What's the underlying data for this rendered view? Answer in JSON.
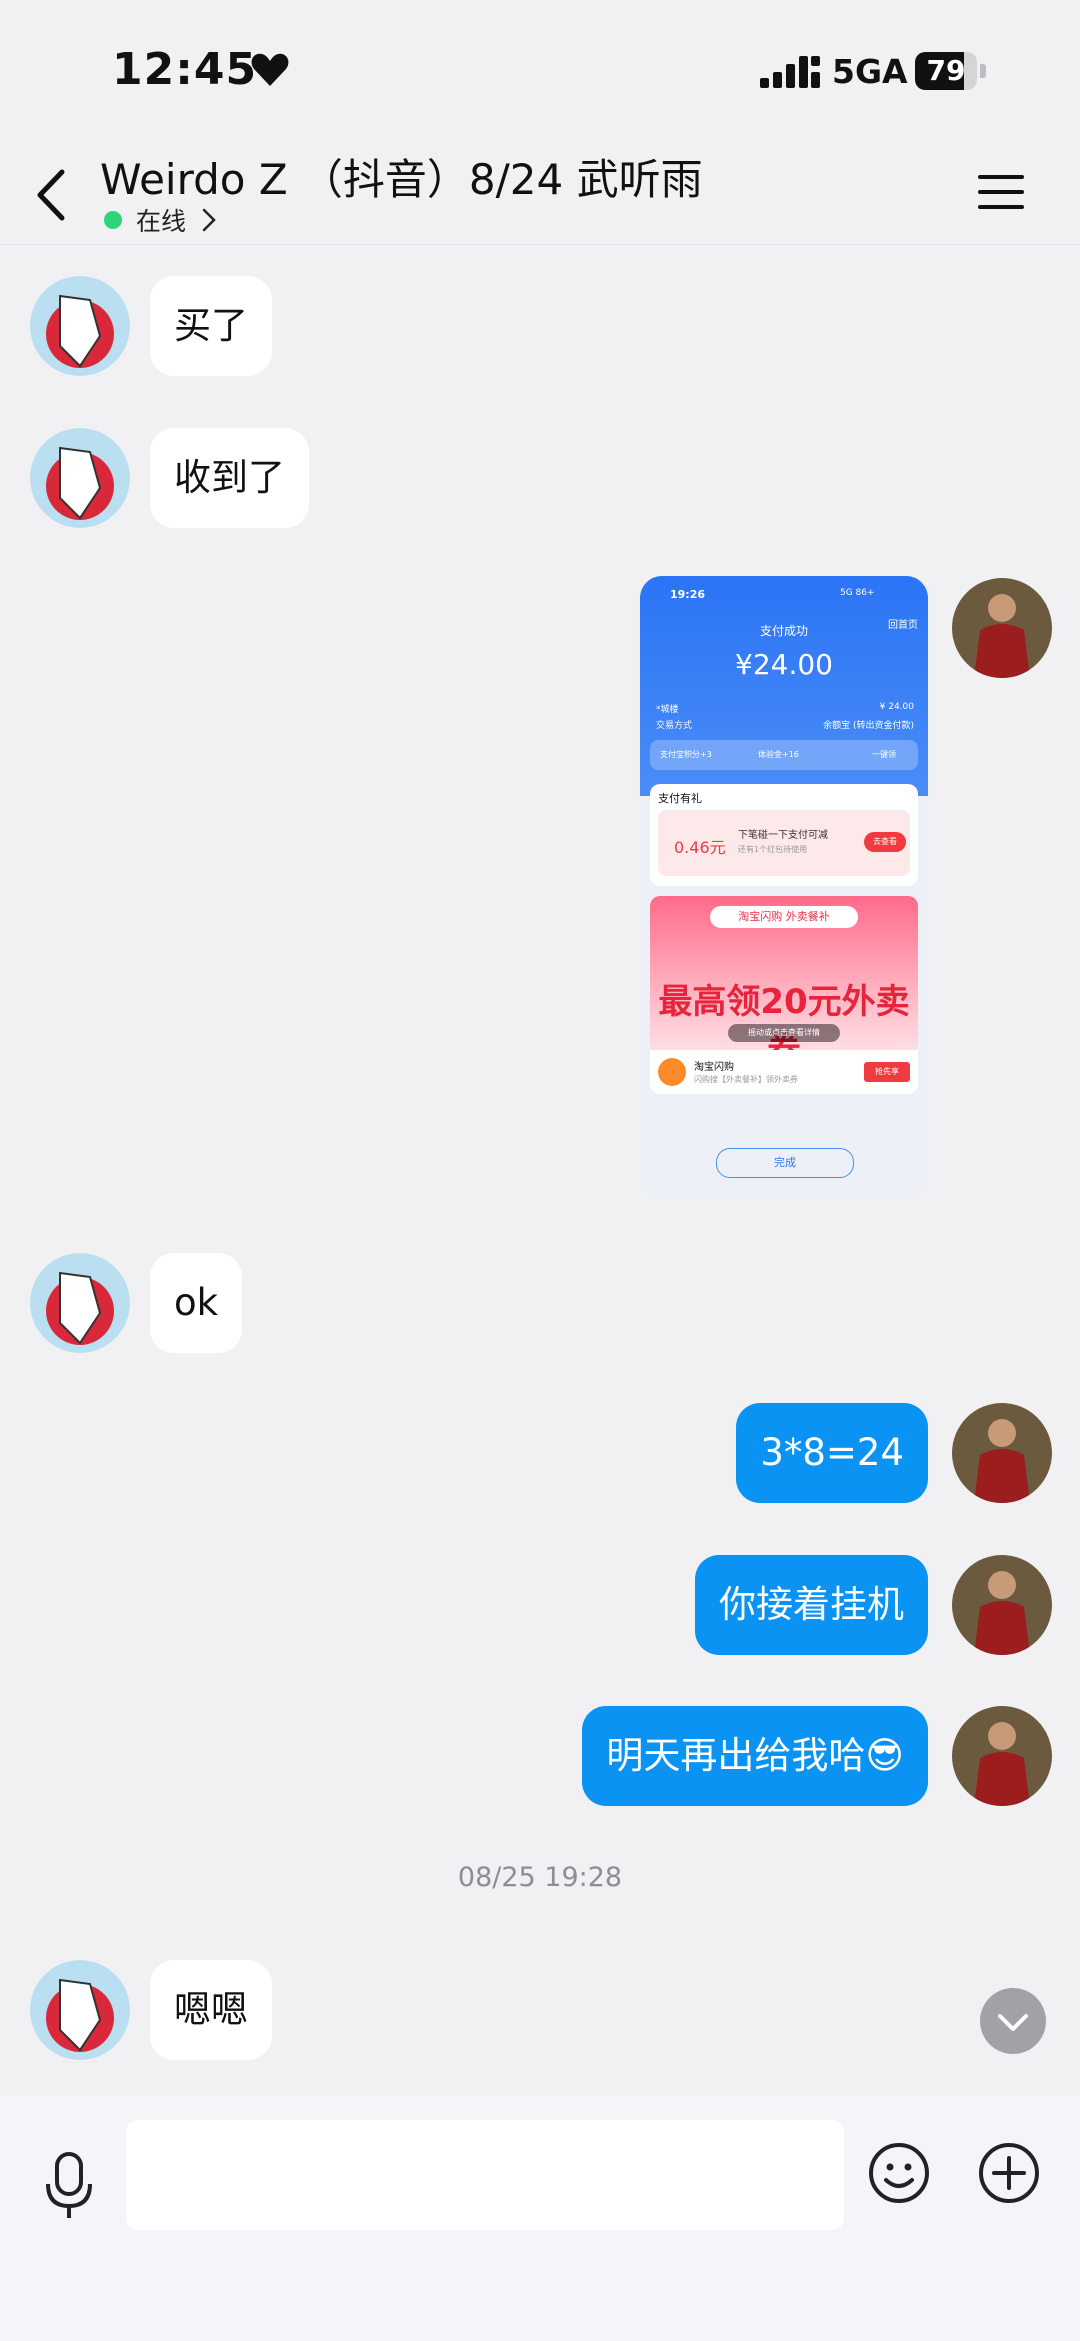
{
  "status_bar": {
    "time": "12:45",
    "network": "5GA",
    "battery_level": "79",
    "battery_fraction": 0.79
  },
  "header": {
    "title": "Weirdo Z （抖音）8/24 武听雨",
    "status": "在线"
  },
  "messages": [
    {
      "side": "in",
      "text": "买了"
    },
    {
      "side": "in",
      "text": "收到了"
    },
    {
      "side": "out",
      "type": "image"
    },
    {
      "side": "in",
      "text": "ok"
    },
    {
      "side": "out",
      "text": "3*8=24"
    },
    {
      "side": "out",
      "text": "你接着挂机"
    },
    {
      "side": "out",
      "text": "明天再出给我哈😎"
    },
    {
      "side": "timestamp",
      "text": "08/25 19:28"
    },
    {
      "side": "in",
      "text": "嗯嗯"
    }
  ],
  "shared_screenshot": {
    "time": "19:26",
    "status": "5G 86+",
    "back_home": "回首页",
    "success": "支付成功",
    "amount": "¥24.00",
    "row1_left": "*城楼",
    "row1_right": "¥ 24.00",
    "row2_left": "交易方式",
    "row2_right": "余额宝 (转出资金付款)",
    "pill_points": "支付宝积分+3",
    "pill_exp": "体验金+16",
    "pill_collect": "一键领",
    "gift_title": "支付有礼",
    "coupon_value": "0.46元",
    "coupon_text": "下笔碰一下支付可减",
    "coupon_sub": "还有1个红包待使用",
    "coupon_button": "去查看",
    "ad_tag": "淘宝闪购 外卖餐补",
    "ad_main": "最高领20元外卖券",
    "ad_sub": "摇动或点击查看详情",
    "shop_name": "淘宝闪购",
    "shop_sub": "闪购搜【外卖餐补】领外卖券",
    "shop_button": "抢先享",
    "done": "完成"
  },
  "input": {
    "value": ""
  },
  "icons": {
    "back": "chevron-left-icon",
    "menu": "hamburger-menu-icon",
    "mic": "microphone-icon",
    "emoji": "smiley-icon",
    "plus": "plus-circle-icon",
    "scroll": "chevron-down-icon"
  },
  "colors": {
    "outgoing_bubble": "#0b93f4",
    "incoming_bubble": "#ffffff",
    "online_dot": "#2ed47a",
    "background": "#f1f1f4"
  }
}
